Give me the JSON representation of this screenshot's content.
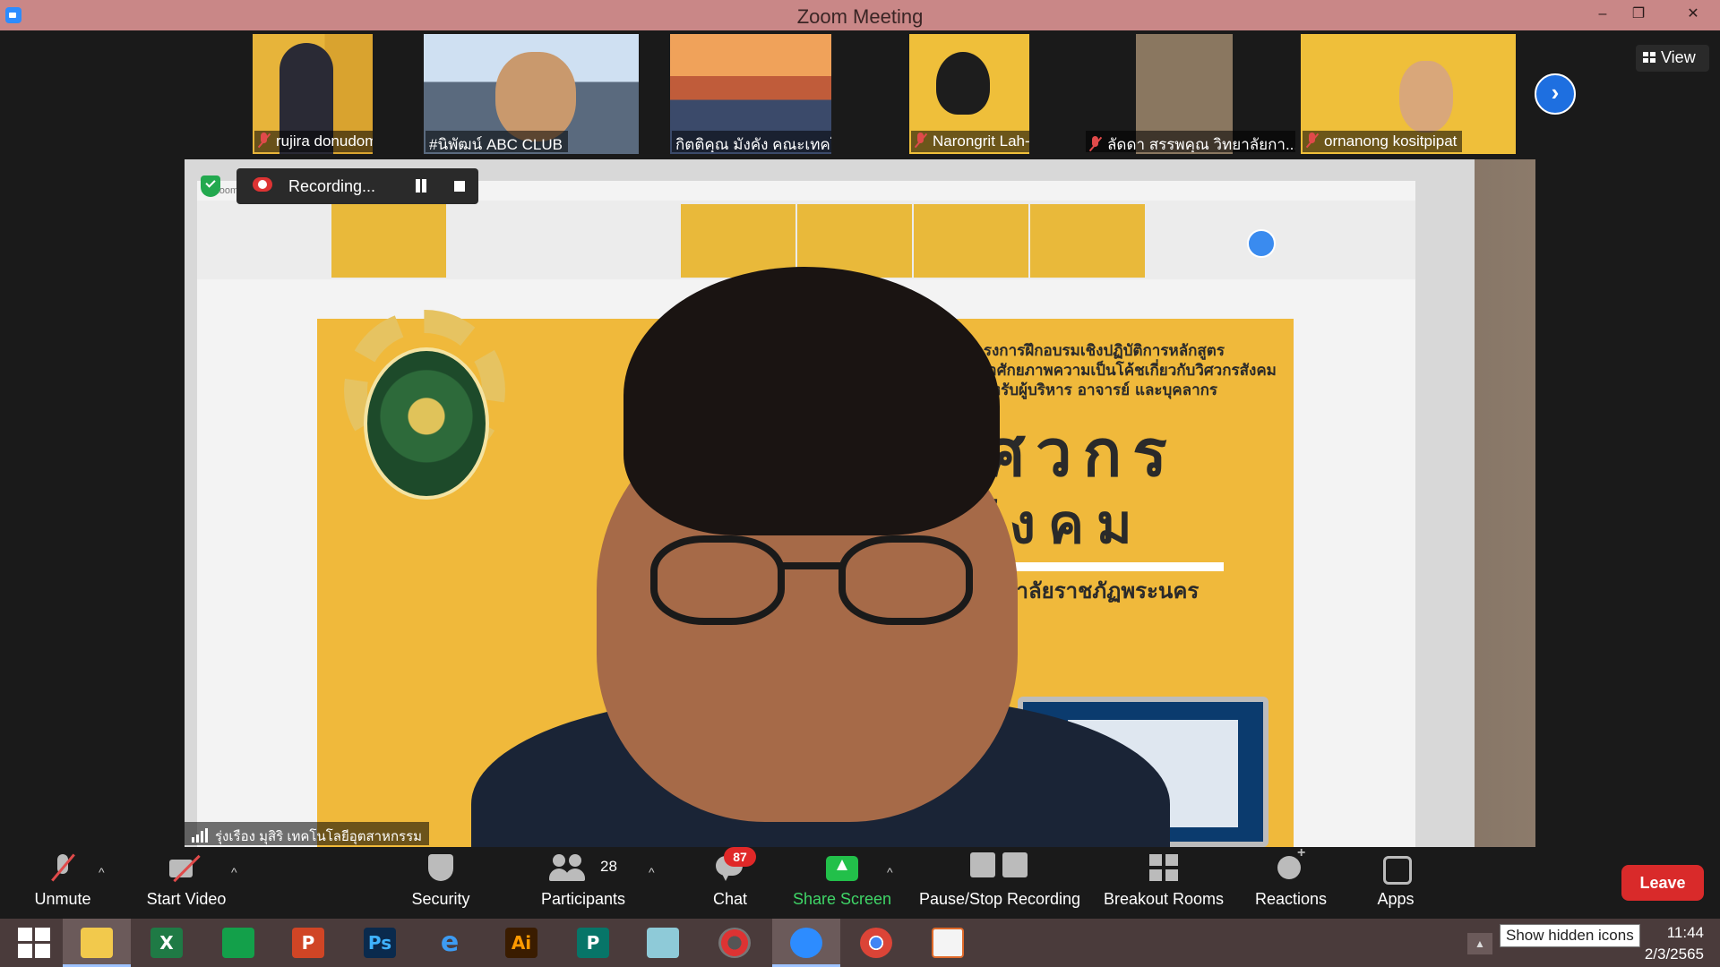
{
  "window": {
    "title": "Zoom Meeting",
    "minimize_glyph": "–",
    "restore_glyph": "❐",
    "close_glyph": "✕"
  },
  "gallery": {
    "participants": [
      {
        "name": "rujira donudom",
        "muted": true
      },
      {
        "name": "#นิพัฒน์ ABC CLUB",
        "muted": false
      },
      {
        "name": "กิตติคุณ มังคัง คณะเทคโนโลยีอุ...",
        "muted": false
      },
      {
        "name": "Narongrit Lah-Pun",
        "muted": true
      },
      {
        "name": "ลัดดา สรรพคุณ วิทยาลัยกา...",
        "muted": true
      },
      {
        "name": "ornanong kositpipat",
        "muted": true
      }
    ],
    "next_glyph": "›",
    "view_label": "View"
  },
  "recording": {
    "label": "Recording..."
  },
  "main_video": {
    "inner_window_title": "Zoom Meeting",
    "poster": {
      "line1": "อบรมโครงการฝึกอบรมเชิงปฏิบัติการหลักสูตร",
      "line2": "การพัฒนาศักยภาพความเป็นโค้ชเกี่ยวกับวิศวกรสังคม",
      "line3": "สำหรับผู้บริหาร อาจารย์ และบุคลากร",
      "big1": "วิศวกร",
      "big2": "สังคม",
      "sub": "มหาวิทยาลัยราชภัฏพระนคร"
    },
    "speaker_name": "รุ่งเรือง มุสิริ เทคโนโลยีอุตสาหกรรม"
  },
  "toolbar": {
    "unmute": "Unmute",
    "start_video": "Start Video",
    "security": "Security",
    "participants": "Participants",
    "participants_count": "28",
    "chat": "Chat",
    "chat_badge": "87",
    "share_screen": "Share Screen",
    "pause_stop_recording": "Pause/Stop Recording",
    "breakout_rooms": "Breakout Rooms",
    "reactions": "Reactions",
    "apps": "Apps",
    "leave": "Leave",
    "caret": "^",
    "colors": {
      "leave": "#d92a2a",
      "share": "#22c04a",
      "badge": "#e02828"
    }
  },
  "taskbar": {
    "apps": [
      {
        "name": "start",
        "label": ""
      },
      {
        "name": "file-explorer",
        "label": ""
      },
      {
        "name": "excel",
        "label": "X"
      },
      {
        "name": "store",
        "label": ""
      },
      {
        "name": "powerpoint",
        "label": "P"
      },
      {
        "name": "photoshop",
        "label": "Ps"
      },
      {
        "name": "internet-explorer",
        "label": "e"
      },
      {
        "name": "illustrator",
        "label": "Ai"
      },
      {
        "name": "publisher",
        "label": "P"
      },
      {
        "name": "notepad",
        "label": ""
      },
      {
        "name": "photoscape",
        "label": ""
      },
      {
        "name": "zoom",
        "label": ""
      },
      {
        "name": "chrome",
        "label": ""
      },
      {
        "name": "presentation-app",
        "label": ""
      }
    ],
    "tooltip": "Show hidden icons",
    "time": "11:44",
    "date": "2/3/2565",
    "tray_glyph": "▲"
  }
}
